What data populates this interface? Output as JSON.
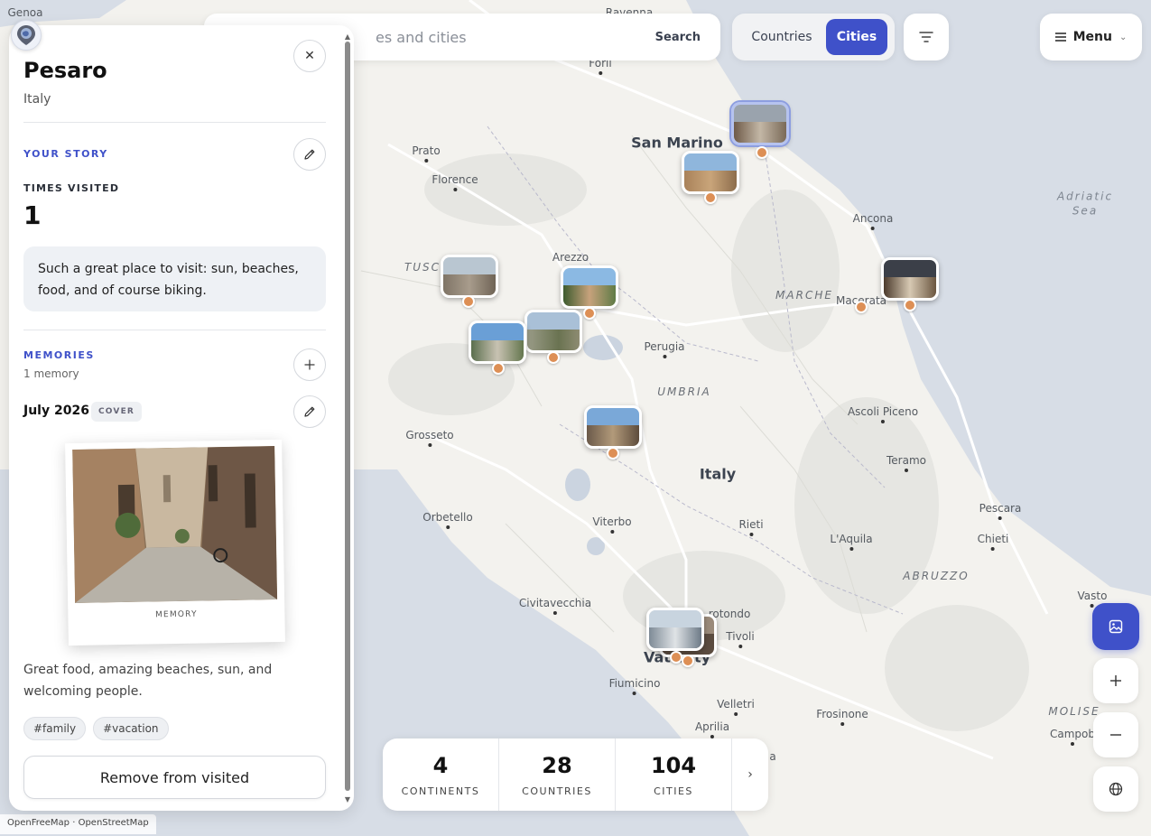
{
  "map": {
    "places": [
      {
        "name": "Genoa",
        "type": "city"
      },
      {
        "name": "Ravenna",
        "type": "city"
      },
      {
        "name": "Forlì",
        "type": "city"
      },
      {
        "name": "San Marino",
        "type": "big"
      },
      {
        "name": "Prato",
        "type": "city"
      },
      {
        "name": "Florence",
        "type": "city"
      },
      {
        "name": "Ancona",
        "type": "city"
      },
      {
        "name": "Adriatic Sea",
        "type": "sea"
      },
      {
        "name": "Arezzo",
        "type": "city"
      },
      {
        "name": "TUSC",
        "type": "region"
      },
      {
        "name": "MARCHE",
        "type": "region"
      },
      {
        "name": "Macerata",
        "type": "city"
      },
      {
        "name": "Perugia",
        "type": "city"
      },
      {
        "name": "UMBRIA",
        "type": "region"
      },
      {
        "name": "Grosseto",
        "type": "city"
      },
      {
        "name": "Ascoli Piceno",
        "type": "city"
      },
      {
        "name": "Italy",
        "type": "country"
      },
      {
        "name": "Teramo",
        "type": "city"
      },
      {
        "name": "Orbetello",
        "type": "city"
      },
      {
        "name": "Viterbo",
        "type": "city"
      },
      {
        "name": "Rieti",
        "type": "city"
      },
      {
        "name": "Pescara",
        "type": "city"
      },
      {
        "name": "L'Aquila",
        "type": "city"
      },
      {
        "name": "Chieti",
        "type": "city"
      },
      {
        "name": "ABRUZZO",
        "type": "region"
      },
      {
        "name": "Civitavecchia",
        "type": "city"
      },
      {
        "name": "Vasto",
        "type": "city"
      },
      {
        "name": "rotondo",
        "type": "city"
      },
      {
        "name": "Tivoli",
        "type": "city"
      },
      {
        "name": "Vatic      ity",
        "type": "big"
      },
      {
        "name": "Fiumicino",
        "type": "city"
      },
      {
        "name": "Velletri",
        "type": "city"
      },
      {
        "name": "Frosinone",
        "type": "city"
      },
      {
        "name": "MOLISE",
        "type": "region"
      },
      {
        "name": "Campob",
        "type": "city"
      },
      {
        "name": "Aprilia",
        "type": "city"
      },
      {
        "name": "a",
        "type": "city"
      }
    ],
    "attribution": "OpenFreeMap · OpenStreetMap"
  },
  "search": {
    "placeholder": "es and cities",
    "button": "Search"
  },
  "toggle": {
    "countries": "Countries",
    "cities": "Cities",
    "active": "Cities"
  },
  "menu": {
    "label": "Menu"
  },
  "panel": {
    "city": "Pesaro",
    "country": "Italy",
    "story_label": "YOUR STORY",
    "times_visited_label": "TIMES VISITED",
    "times_visited": "1",
    "story_text": "Such a great place to visit: sun, beaches, food, and of course biking.",
    "memories_label": "MEMORIES",
    "memories_count": "1 memory",
    "memory": {
      "date": "July 2026",
      "badge": "COVER",
      "caption": "MEMORY",
      "description": "Great food, amazing beaches, sun, and welcoming people.",
      "tags": [
        "#family",
        "#vacation"
      ]
    },
    "remove_label": "Remove from visited"
  },
  "stats": [
    {
      "value": "4",
      "label": "CONTINENTS"
    },
    {
      "value": "28",
      "label": "COUNTRIES"
    },
    {
      "value": "104",
      "label": "CITIES"
    }
  ],
  "colors": {
    "accent": "#3f51c9",
    "pin": "#dd8f55",
    "water": "#d7dde6",
    "land": "#f3f2ee"
  },
  "icons": {
    "close": "close-icon",
    "edit": "pencil-icon",
    "add": "plus-icon",
    "filter": "filter-icon",
    "menu": "hamburger-icon",
    "gallery": "image-icon",
    "zoom_in": "plus-icon",
    "zoom_out": "minus-icon",
    "globe": "globe-icon"
  }
}
